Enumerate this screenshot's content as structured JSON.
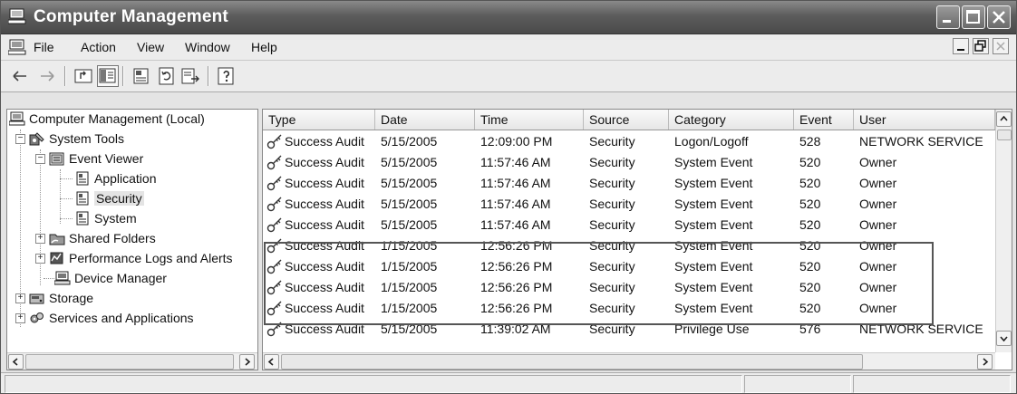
{
  "window": {
    "title": "Computer Management",
    "icon": "computer-icon"
  },
  "menu": {
    "items": [
      "File",
      "Action",
      "View",
      "Window",
      "Help"
    ]
  },
  "toolbar": {
    "icons": [
      "back-arrow-icon",
      "forward-arrow-icon",
      "up-folder-icon",
      "show-hide-tree-icon",
      "properties-icon",
      "refresh-icon",
      "export-list-icon",
      "help-icon"
    ]
  },
  "tree": {
    "items": [
      {
        "label": "Computer Management (Local)",
        "icon": "computer-icon"
      },
      {
        "label": "System Tools",
        "icon": "system-tools-icon",
        "expanded": true
      },
      {
        "label": "Event Viewer",
        "icon": "event-viewer-icon",
        "expanded": true
      },
      {
        "label": "Application",
        "icon": "log-icon"
      },
      {
        "label": "Security",
        "icon": "log-icon",
        "selected": true
      },
      {
        "label": "System",
        "icon": "log-icon"
      },
      {
        "label": "Shared Folders",
        "icon": "shared-folder-icon",
        "expanded": false
      },
      {
        "label": "Performance Logs and Alerts",
        "icon": "performance-icon",
        "expanded": false
      },
      {
        "label": "Device Manager",
        "icon": "device-manager-icon"
      },
      {
        "label": "Storage",
        "icon": "storage-icon",
        "expanded": false
      },
      {
        "label": "Services and Applications",
        "icon": "services-icon",
        "expanded": false
      }
    ]
  },
  "list": {
    "columns": [
      "Type",
      "Date",
      "Time",
      "Source",
      "Category",
      "Event",
      "User"
    ],
    "rows": [
      {
        "type": "Success Audit",
        "date": "5/15/2005",
        "time": "12:09:00 PM",
        "source": "Security",
        "category": "Logon/Logoff",
        "event": "528",
        "user": "NETWORK SERVICE"
      },
      {
        "type": "Success Audit",
        "date": "5/15/2005",
        "time": "11:57:46 AM",
        "source": "Security",
        "category": "System Event",
        "event": "520",
        "user": "Owner"
      },
      {
        "type": "Success Audit",
        "date": "5/15/2005",
        "time": "11:57:46 AM",
        "source": "Security",
        "category": "System Event",
        "event": "520",
        "user": "Owner"
      },
      {
        "type": "Success Audit",
        "date": "5/15/2005",
        "time": "11:57:46 AM",
        "source": "Security",
        "category": "System Event",
        "event": "520",
        "user": "Owner"
      },
      {
        "type": "Success Audit",
        "date": "5/15/2005",
        "time": "11:57:46 AM",
        "source": "Security",
        "category": "System Event",
        "event": "520",
        "user": "Owner"
      },
      {
        "type": "Success Audit",
        "date": "1/15/2005",
        "time": "12:56:26 PM",
        "source": "Security",
        "category": "System Event",
        "event": "520",
        "user": "Owner"
      },
      {
        "type": "Success Audit",
        "date": "1/15/2005",
        "time": "12:56:26 PM",
        "source": "Security",
        "category": "System Event",
        "event": "520",
        "user": "Owner"
      },
      {
        "type": "Success Audit",
        "date": "1/15/2005",
        "time": "12:56:26 PM",
        "source": "Security",
        "category": "System Event",
        "event": "520",
        "user": "Owner"
      },
      {
        "type": "Success Audit",
        "date": "1/15/2005",
        "time": "12:56:26 PM",
        "source": "Security",
        "category": "System Event",
        "event": "520",
        "user": "Owner"
      },
      {
        "type": "Success Audit",
        "date": "5/15/2005",
        "time": "11:39:02 AM",
        "source": "Security",
        "category": "Privilege Use",
        "event": "576",
        "user": "NETWORK SERVICE"
      }
    ]
  },
  "colors": {
    "titlebar": "#5c5c5c",
    "window_bg": "#e4e4e4",
    "highlight_border": "#555555"
  }
}
